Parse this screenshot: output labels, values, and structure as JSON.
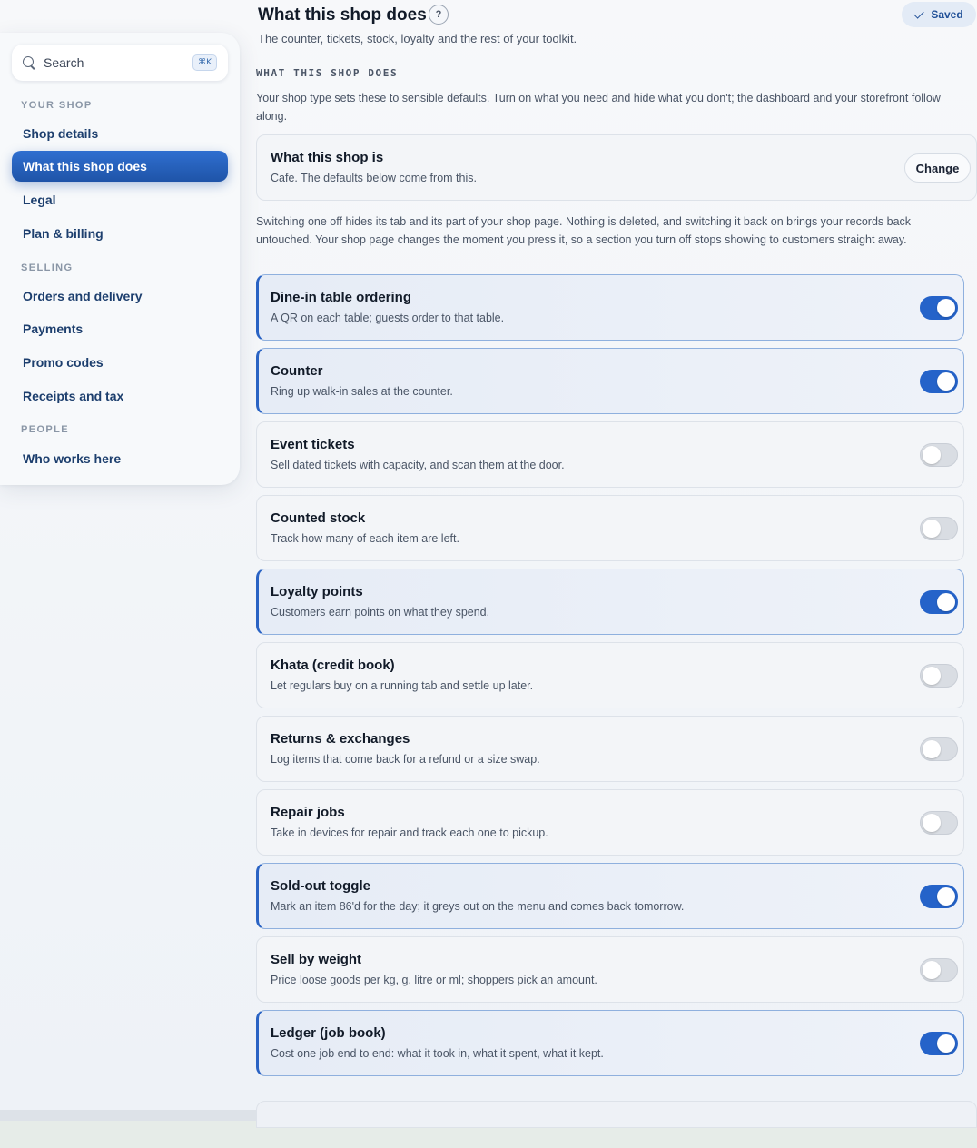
{
  "sidebar": {
    "search": {
      "label": "Search",
      "shortcut": "⌘K"
    },
    "sections": [
      {
        "label": "YOUR SHOP"
      },
      {
        "label": "SELLING"
      },
      {
        "label": "PEOPLE"
      }
    ],
    "items": [
      {
        "label": "Shop details"
      },
      {
        "label": "What this shop does"
      },
      {
        "label": "Legal"
      },
      {
        "label": "Plan & billing"
      },
      {
        "label": "Orders and delivery"
      },
      {
        "label": "Payments"
      },
      {
        "label": "Promo codes"
      },
      {
        "label": "Receipts and tax"
      },
      {
        "label": "Who works here"
      }
    ],
    "active_item": "What this shop does"
  },
  "header": {
    "title": "What this shop does",
    "help": "?",
    "saved_label": "Saved",
    "subtitle": "The counter, tickets, stock, loyalty and the rest of your toolkit."
  },
  "section": {
    "label": "WHAT THIS SHOP DOES",
    "intro": "Your shop type sets these to sensible defaults. Turn on what you need and hide what you don't; the dashboard and your storefront follow along.",
    "shop_type": {
      "title": "What this shop is",
      "desc": "Cafe. The defaults below come from this.",
      "change_label": "Change"
    },
    "switch_note": "Switching one off hides its tab and its part of your shop page. Nothing is deleted, and switching it back on brings your records back untouched. Your shop page changes the moment you press it, so a section you turn off stops showing to customers straight away."
  },
  "features": [
    {
      "title": "Dine-in table ordering",
      "desc": "A QR on each table; guests order to that table.",
      "enabled": true
    },
    {
      "title": "Counter",
      "desc": "Ring up walk-in sales at the counter.",
      "enabled": true
    },
    {
      "title": "Event tickets",
      "desc": "Sell dated tickets with capacity, and scan them at the door.",
      "enabled": false
    },
    {
      "title": "Counted stock",
      "desc": "Track how many of each item are left.",
      "enabled": false
    },
    {
      "title": "Loyalty points",
      "desc": "Customers earn points on what they spend.",
      "enabled": true
    },
    {
      "title": "Khata (credit book)",
      "desc": "Let regulars buy on a running tab and settle up later.",
      "enabled": false
    },
    {
      "title": "Returns & exchanges",
      "desc": "Log items that come back for a refund or a size swap.",
      "enabled": false
    },
    {
      "title": "Repair jobs",
      "desc": "Take in devices for repair and track each one to pickup.",
      "enabled": false
    },
    {
      "title": "Sold-out toggle",
      "desc": "Mark an item 86'd for the day; it greys out on the menu and comes back tomorrow.",
      "enabled": true
    },
    {
      "title": "Sell by weight",
      "desc": "Price loose goods per kg, g, litre or ml; shoppers pick an amount.",
      "enabled": false
    },
    {
      "title": "Ledger (job book)",
      "desc": "Cost one job end to end: what it took in, what it spent, what it kept.",
      "enabled": true
    }
  ],
  "colors": {
    "accent": "#2563c9",
    "nav_text": "#1d3f6e",
    "toggle_off": "#d9dde3"
  }
}
